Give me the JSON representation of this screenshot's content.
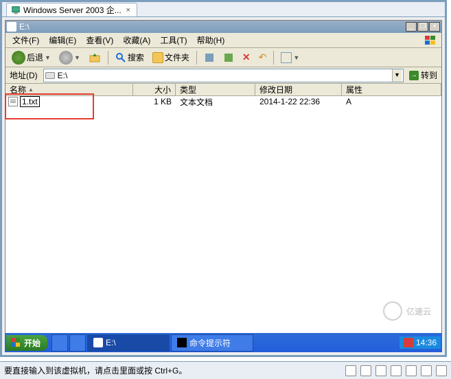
{
  "vm": {
    "tab_title": "Windows Server 2003 企..."
  },
  "explorer": {
    "title": "E:\\",
    "menu": {
      "file": "文件(F)",
      "edit": "编辑(E)",
      "view": "查看(V)",
      "favorites": "收藏(A)",
      "tools": "工具(T)",
      "help": "帮助(H)"
    },
    "toolbar": {
      "back": "后退",
      "search": "搜索",
      "folders": "文件夹"
    },
    "address": {
      "label": "地址(D)",
      "value": "E:\\",
      "go": "转到"
    },
    "columns": {
      "name": "名称",
      "size": "大小",
      "type": "类型",
      "modified": "修改日期",
      "attributes": "属性"
    },
    "files": [
      {
        "name": "1.txt",
        "size": "1 KB",
        "type": "文本文档",
        "modified": "2014-1-22 22:36",
        "attributes": "A"
      }
    ]
  },
  "taskbar": {
    "start": "开始",
    "tasks": [
      {
        "label": "E:\\"
      },
      {
        "label": "命令提示符"
      }
    ],
    "clock": "14:36"
  },
  "hint": {
    "text": "要直接输入到该虚拟机，请点击里面或按 Ctrl+G。"
  },
  "watermark": "亿速云"
}
